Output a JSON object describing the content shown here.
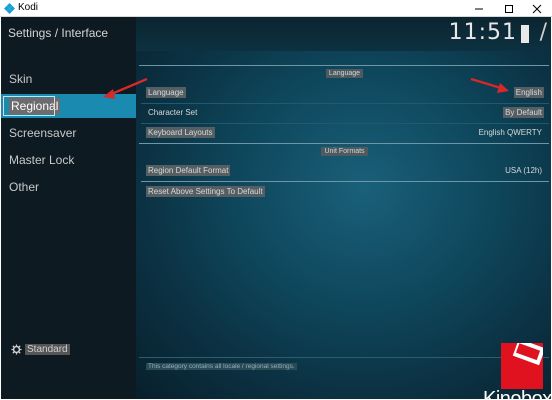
{
  "window": {
    "title": "Kodi",
    "minimize_icon": "minimize-icon",
    "maximize_icon": "maximize-icon",
    "close_icon": "close-icon"
  },
  "sidebar": {
    "breadcrumb": "Settings / Interface",
    "items": [
      {
        "label": "Skin"
      },
      {
        "label": "Regional"
      },
      {
        "label": "Screensaver"
      },
      {
        "label": "Master Lock"
      },
      {
        "label": "Other"
      }
    ],
    "selected_index": 1,
    "level_label": "Standard",
    "level_icon": "gear-icon"
  },
  "header": {
    "clock": "11:51"
  },
  "sections": [
    {
      "title": "Language"
    },
    {
      "title": "Unit Formats"
    }
  ],
  "rows": [
    {
      "label": "Language",
      "value": "English"
    },
    {
      "label": "Character Set",
      "value": "By Default"
    },
    {
      "label": "Keyboard Layouts",
      "value": "English QWERTY"
    },
    {
      "label": "Region Default Format",
      "value": "USA (12h)"
    },
    {
      "label": "Reset Above Settings To Default",
      "value": ""
    }
  ],
  "footer": {
    "description": "This category contains all locale / regional settings."
  },
  "watermark": {
    "text": "Kinobox"
  },
  "colors": {
    "selected_bg": "#1a8ab0",
    "sidebar_bg": "#0d1a21",
    "main_bg": "#0f4a60",
    "annotation_arrow": "#d42a2a",
    "watermark_red": "#e0121f"
  }
}
